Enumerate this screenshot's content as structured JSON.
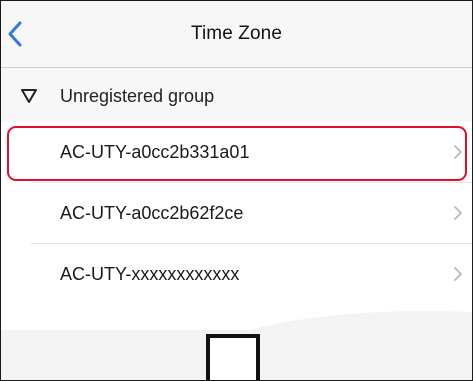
{
  "nav": {
    "title": "Time Zone",
    "back_icon": "chevron-left-icon",
    "accent_color": "#2f7ad8"
  },
  "group": {
    "label": "Unregistered group",
    "icon": "triangle-down-icon"
  },
  "devices": [
    {
      "label": "AC-UTY-a0cc2b331a01",
      "highlighted": true
    },
    {
      "label": "AC-UTY-a0cc2b62f2ce",
      "highlighted": false
    },
    {
      "label": "AC-UTY-xxxxxxxxxxxx",
      "highlighted": false
    }
  ],
  "colors": {
    "highlight": "#e0102a",
    "bar_background": "#f7f7f7"
  }
}
